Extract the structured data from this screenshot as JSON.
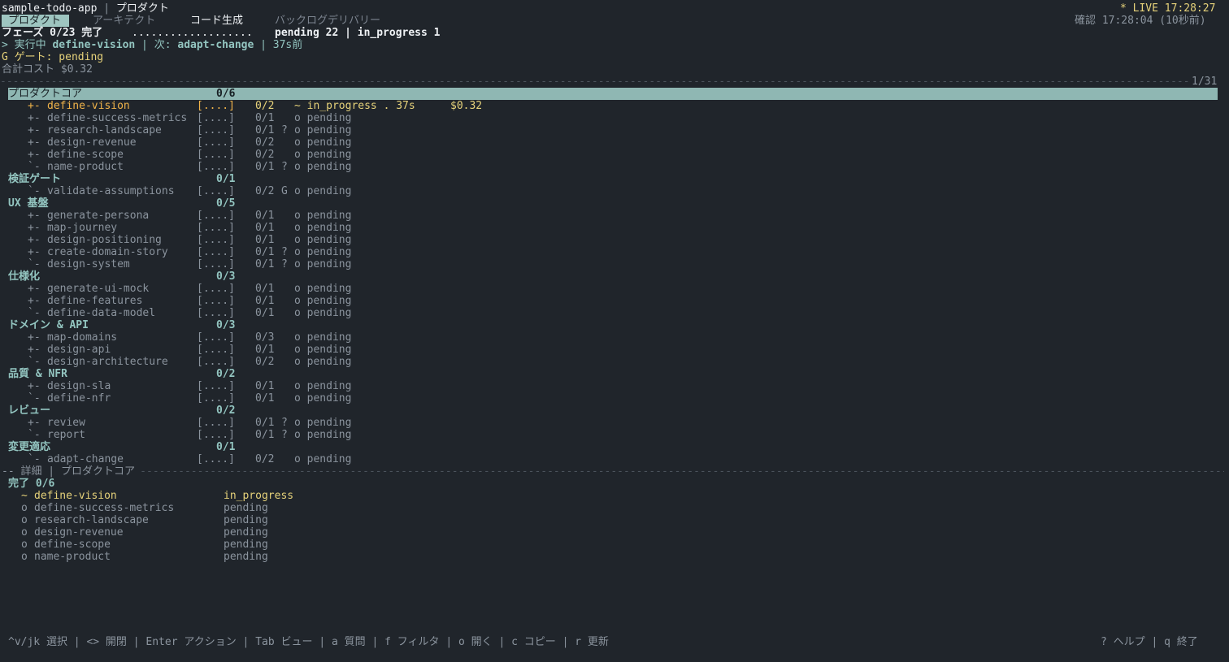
{
  "header": {
    "app_name": "sample-todo-app",
    "separator": " | ",
    "view_name": "プロダクト",
    "live_label": "* LIVE 17:28:27",
    "confirm_label": "確認 17:28:04 (10秒前)"
  },
  "tabs": [
    {
      "label": "プロダクト"
    },
    {
      "label": "アーキテクト"
    },
    {
      "label": "コード生成"
    },
    {
      "label": "バックログデリバリー"
    }
  ],
  "status": {
    "phase_label": "フェーズ 0/23 完了",
    "phase_dots": "...................",
    "phase_counts": "pending 22 | in_progress 1",
    "running_prefix": "> 実行中 ",
    "running_task": "define-vision",
    "next_label": " | 次: ",
    "next_task": "adapt-change",
    "elapsed": " | 37s前",
    "gate_label": "G ゲート: pending",
    "total_cost": "合計コスト $0.32",
    "page_indicator": "1/31"
  },
  "groups": [
    {
      "name": "プロダクトコア",
      "count": "0/6",
      "selected": true,
      "items": [
        {
          "tree": "+-",
          "name": "define-vision",
          "bar": "[....]",
          "frac": "0/2",
          "gate": "",
          "state": "~ in_progress . 37s",
          "cost": "$0.32",
          "active": true
        },
        {
          "tree": "+-",
          "name": "define-success-metrics",
          "bar": "[....]",
          "frac": "0/1",
          "gate": "",
          "state": "o pending"
        },
        {
          "tree": "+-",
          "name": "research-landscape",
          "bar": "[....]",
          "frac": "0/1",
          "gate": "?",
          "state": "o pending"
        },
        {
          "tree": "+-",
          "name": "design-revenue",
          "bar": "[....]",
          "frac": "0/2",
          "gate": "",
          "state": "o pending"
        },
        {
          "tree": "+-",
          "name": "define-scope",
          "bar": "[....]",
          "frac": "0/2",
          "gate": "",
          "state": "o pending"
        },
        {
          "tree": "`-",
          "name": "name-product",
          "bar": "[....]",
          "frac": "0/1",
          "gate": "?",
          "state": "o pending"
        }
      ]
    },
    {
      "name": "検証ゲート",
      "count": "0/1",
      "items": [
        {
          "tree": "`-",
          "name": "validate-assumptions",
          "bar": "[....]",
          "frac": "0/2",
          "gate": "G",
          "state": "o pending"
        }
      ]
    },
    {
      "name": "UX 基盤",
      "count": "0/5",
      "items": [
        {
          "tree": "+-",
          "name": "generate-persona",
          "bar": "[....]",
          "frac": "0/1",
          "gate": "",
          "state": "o pending"
        },
        {
          "tree": "+-",
          "name": "map-journey",
          "bar": "[....]",
          "frac": "0/1",
          "gate": "",
          "state": "o pending"
        },
        {
          "tree": "+-",
          "name": "design-positioning",
          "bar": "[....]",
          "frac": "0/1",
          "gate": "",
          "state": "o pending"
        },
        {
          "tree": "+-",
          "name": "create-domain-story",
          "bar": "[....]",
          "frac": "0/1",
          "gate": "?",
          "state": "o pending"
        },
        {
          "tree": "`-",
          "name": "design-system",
          "bar": "[....]",
          "frac": "0/1",
          "gate": "?",
          "state": "o pending"
        }
      ]
    },
    {
      "name": "仕様化",
      "count": "0/3",
      "items": [
        {
          "tree": "+-",
          "name": "generate-ui-mock",
          "bar": "[....]",
          "frac": "0/1",
          "gate": "",
          "state": "o pending"
        },
        {
          "tree": "+-",
          "name": "define-features",
          "bar": "[....]",
          "frac": "0/1",
          "gate": "",
          "state": "o pending"
        },
        {
          "tree": "`-",
          "name": "define-data-model",
          "bar": "[....]",
          "frac": "0/1",
          "gate": "",
          "state": "o pending"
        }
      ]
    },
    {
      "name": "ドメイン & API",
      "count": "0/3",
      "items": [
        {
          "tree": "+-",
          "name": "map-domains",
          "bar": "[....]",
          "frac": "0/3",
          "gate": "",
          "state": "o pending"
        },
        {
          "tree": "+-",
          "name": "design-api",
          "bar": "[....]",
          "frac": "0/1",
          "gate": "",
          "state": "o pending"
        },
        {
          "tree": "`-",
          "name": "design-architecture",
          "bar": "[....]",
          "frac": "0/2",
          "gate": "",
          "state": "o pending"
        }
      ]
    },
    {
      "name": "品質 & NFR",
      "count": "0/2",
      "items": [
        {
          "tree": "+-",
          "name": "design-sla",
          "bar": "[....]",
          "frac": "0/1",
          "gate": "",
          "state": "o pending"
        },
        {
          "tree": "`-",
          "name": "define-nfr",
          "bar": "[....]",
          "frac": "0/1",
          "gate": "",
          "state": "o pending"
        }
      ]
    },
    {
      "name": "レビュー",
      "count": "0/2",
      "items": [
        {
          "tree": "+-",
          "name": "review",
          "bar": "[....]",
          "frac": "0/1",
          "gate": "?",
          "state": "o pending"
        },
        {
          "tree": "`-",
          "name": "report",
          "bar": "[....]",
          "frac": "0/1",
          "gate": "?",
          "state": "o pending"
        }
      ]
    },
    {
      "name": "変更適応",
      "count": "0/1",
      "items": [
        {
          "tree": "`-",
          "name": "adapt-change",
          "bar": "[....]",
          "frac": "0/2",
          "gate": "",
          "state": "o pending"
        }
      ]
    }
  ],
  "detail": {
    "header": "-- 詳細 | プロダクトコア",
    "done_label": "完了 0/6",
    "items": [
      {
        "symbol": "~",
        "name": "define-vision",
        "status": "in_progress",
        "active": true
      },
      {
        "symbol": "o",
        "name": "define-success-metrics",
        "status": "pending"
      },
      {
        "symbol": "o",
        "name": "research-landscape",
        "status": "pending"
      },
      {
        "symbol": "o",
        "name": "design-revenue",
        "status": "pending"
      },
      {
        "symbol": "o",
        "name": "define-scope",
        "status": "pending"
      },
      {
        "symbol": "o",
        "name": "name-product",
        "status": "pending"
      }
    ]
  },
  "footer": {
    "keys": "^v/jk 選択 | <> 開閉 | Enter アクション | Tab ビュー | a 質問 | f フィルタ | o 開く | c コピー | r 更新",
    "right": "? ヘルプ | q 終了"
  },
  "colors": {
    "background": "#20252b",
    "accent_teal": "#93c5c0",
    "active_orange": "#f0b34a",
    "gate_yellow": "#e6d27a"
  }
}
